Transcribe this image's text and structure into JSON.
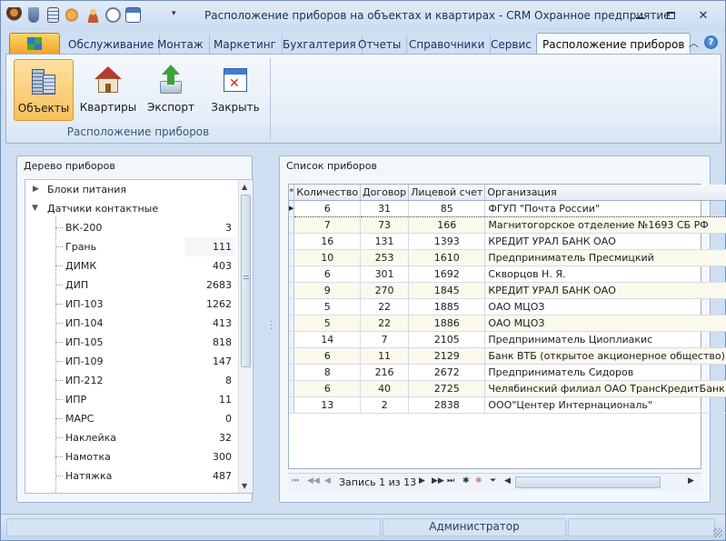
{
  "window": {
    "title": "Расположение приборов на объектах и квартирах - CRM Охранное предприятие"
  },
  "window_controls": [
    "minimize",
    "restore",
    "close"
  ],
  "ribbon": {
    "tabs": [
      "Обслуживание",
      "Монтаж",
      "Маркетинг",
      "Бухгалтерия",
      "Отчеты",
      "Справочники",
      "Сервис",
      "Расположение приборов"
    ],
    "active_tab": "Расположение приборов",
    "buttons": [
      {
        "label": "Объекты",
        "icon": "buildings-icon",
        "pressed": true
      },
      {
        "label": "Квартиры",
        "icon": "house-icon",
        "pressed": false
      },
      {
        "label": "Экспорт",
        "icon": "export-arrow-icon",
        "pressed": false
      },
      {
        "label": "Закрыть",
        "icon": "close-window-icon",
        "pressed": false
      }
    ],
    "group_label": "Расположение приборов"
  },
  "tree_panel": {
    "title": "Дерево приборов",
    "groups": [
      {
        "label": "Блоки питания",
        "expanded": false
      },
      {
        "label": "Датчики контактные",
        "expanded": true
      }
    ],
    "items": [
      {
        "name": "ВК-200",
        "count": "3"
      },
      {
        "name": "Грань",
        "count": "111"
      },
      {
        "name": "ДИМК",
        "count": "403"
      },
      {
        "name": "ДИП",
        "count": "2683"
      },
      {
        "name": "ИП-103",
        "count": "1262"
      },
      {
        "name": "ИП-104",
        "count": "413"
      },
      {
        "name": "ИП-105",
        "count": "818"
      },
      {
        "name": "ИП-109",
        "count": "147"
      },
      {
        "name": "ИП-212",
        "count": "8"
      },
      {
        "name": "ИПР",
        "count": "11"
      },
      {
        "name": "МАРС",
        "count": "0"
      },
      {
        "name": "Наклейка",
        "count": "32"
      },
      {
        "name": "Намотка",
        "count": "300"
      },
      {
        "name": "Натяжка",
        "count": "487"
      }
    ],
    "selected_item": "Грань"
  },
  "list_panel": {
    "title": "Список приборов",
    "columns": [
      "Количество",
      "Договор",
      "Лицевой счет",
      "Организация"
    ],
    "rows": [
      [
        "6",
        "31",
        "85",
        "ФГУП \"Почта России\""
      ],
      [
        "7",
        "73",
        "166",
        "Магнитогорское отделение №1693 СБ РФ"
      ],
      [
        "16",
        "131",
        "1393",
        "КРЕДИТ УРАЛ БАНК ОАО"
      ],
      [
        "10",
        "253",
        "1610",
        "Предприниматель Пресмицкий"
      ],
      [
        "6",
        "301",
        "1692",
        "Скворцов Н. Я."
      ],
      [
        "9",
        "270",
        "1845",
        "КРЕДИТ УРАЛ БАНК ОАО"
      ],
      [
        "5",
        "22",
        "1885",
        "ОАО МЦОЗ"
      ],
      [
        "5",
        "22",
        "1886",
        "ОАО МЦОЗ"
      ],
      [
        "14",
        "7",
        "2105",
        "Предприниматель Циоплиакис"
      ],
      [
        "6",
        "11",
        "2129",
        "Банк ВТБ (открытое акционерное общество)"
      ],
      [
        "8",
        "216",
        "2672",
        "Предприниматель Сидоров"
      ],
      [
        "6",
        "40",
        "2725",
        "Челябинский филиал ОАО ТрансКредитБанк"
      ],
      [
        "13",
        "2",
        "2838",
        "ООО\"Центер Интернациональ\""
      ]
    ],
    "navigator": {
      "record_text": "Запись 1 из 13"
    }
  },
  "status_bar": {
    "user": "Администратор"
  },
  "colors": {
    "accent_orange": "#f5b443",
    "ribbon_blue": "#cfdff1",
    "alt_row": "#fbf8ec"
  }
}
